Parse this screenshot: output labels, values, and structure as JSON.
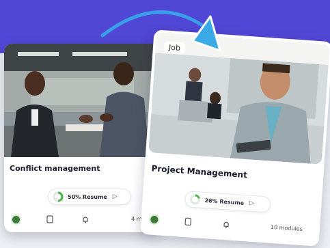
{
  "colors": {
    "accent": "#5147d6",
    "cursor": "#3aa9e6",
    "progress": "#4bb34a"
  },
  "cards": [
    {
      "title": "Conflict management",
      "progress_percent": 50,
      "resume_label": "50% Resume",
      "modules_label": "4 m",
      "icons": [
        "avatar-icon",
        "document-icon",
        "bell-icon"
      ]
    },
    {
      "badge": "Job",
      "title": "Project Management",
      "progress_percent": 26,
      "resume_label": "26% Resume",
      "modules_label": "10 modules",
      "icons": [
        "avatar-icon",
        "document-icon",
        "bell-icon"
      ]
    }
  ]
}
